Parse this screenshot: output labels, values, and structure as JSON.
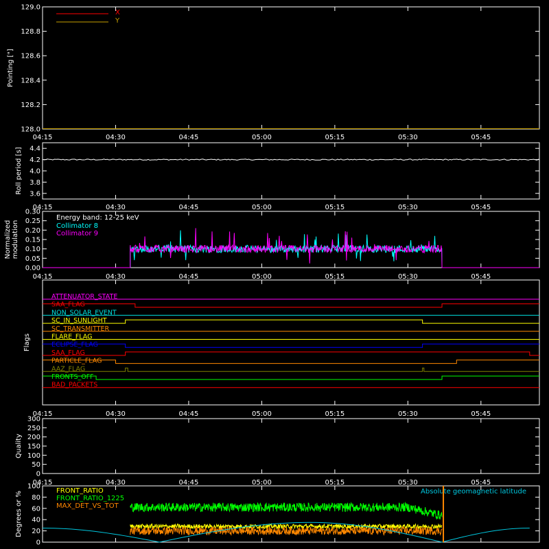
{
  "colors": {
    "bg": "#000000",
    "axes": "#ffffff",
    "x": "#ff0000",
    "y": "#c8a000",
    "roll": "#ffffff",
    "energy": "#ffffff",
    "coll8": "#00ffff",
    "coll9": "#ff00ff",
    "front_ratio": "#ffff00",
    "front_ratio_1225": "#00ff00",
    "max_det": "#ff8800",
    "geolat": "#00c8e0",
    "quality": "#ffffff"
  },
  "time_axis": {
    "min": "04:15",
    "max": "05:57",
    "ticks": [
      "04:15",
      "04:30",
      "04:45",
      "05:00",
      "05:15",
      "05:30",
      "05:45"
    ]
  },
  "chart_data": [
    {
      "id": "pointing",
      "type": "line",
      "ylabel": "Pointing [\"]",
      "ylim": [
        128.0,
        129.0
      ],
      "yticks": [
        "128.0",
        "128.2",
        "128.4",
        "128.6",
        "128.8",
        "129.0"
      ],
      "series": [
        {
          "name": "X",
          "color_key": "x",
          "t": [
            "04:15",
            "05:57"
          ],
          "values": [
            128.0,
            128.0
          ]
        },
        {
          "name": "Y",
          "color_key": "y",
          "t": [
            "04:15",
            "05:57"
          ],
          "values": [
            128.0,
            128.0
          ]
        }
      ]
    },
    {
      "id": "roll",
      "type": "line",
      "ylabel": "Roll period [s]",
      "ylim": [
        3.5,
        4.5
      ],
      "yticks": [
        "3.6",
        "3.8",
        "4.0",
        "4.2",
        "4.4"
      ],
      "series": [
        {
          "color_key": "roll",
          "t": [
            "04:15",
            "05:57"
          ],
          "values": [
            4.2,
            4.2
          ],
          "noise": 0.01
        }
      ]
    },
    {
      "id": "modulation",
      "type": "line",
      "ylabel": [
        "Normalized",
        "modulation"
      ],
      "ylim": [
        0.0,
        0.3
      ],
      "yticks": [
        "0.00",
        "0.05",
        "0.10",
        "0.15",
        "0.20",
        "0.25",
        "0.30"
      ],
      "legend_title": "Energy band: 12-25 keV",
      "active": [
        "04:33",
        "05:37"
      ],
      "series": [
        {
          "name": "Collimator 8",
          "color_key": "coll8",
          "base": 0.1,
          "noise": 0.02
        },
        {
          "name": "Collimator 9",
          "color_key": "coll9",
          "base": 0.1,
          "noise": 0.02
        }
      ]
    },
    {
      "id": "flags",
      "type": "step",
      "ylabel": "Flags",
      "flags": [
        {
          "name": "ATTENUATOR_STATE",
          "color": "#ff00ff",
          "steps": [
            [
              "04:15",
              0
            ]
          ]
        },
        {
          "name": "SAA_FLAG",
          "color": "#ff0000",
          "steps": [
            [
              "04:15",
              1
            ],
            [
              "04:34",
              0
            ],
            [
              "05:37",
              1
            ]
          ]
        },
        {
          "name": "NON_SOLAR_EVENT",
          "color": "#00e0e0",
          "steps": [
            [
              "04:15",
              0
            ]
          ]
        },
        {
          "name": "SC_IN_SUNLIGHT",
          "color": "#ffff00",
          "steps": [
            [
              "04:15",
              0
            ],
            [
              "04:32",
              1
            ],
            [
              "05:33",
              0
            ]
          ]
        },
        {
          "name": "SC_TRANSMITTER",
          "color": "#ff8800",
          "steps": [
            [
              "04:15",
              0
            ]
          ]
        },
        {
          "name": "FLARE_FLAG",
          "color": "#ffff00",
          "steps": [
            [
              "04:15",
              0
            ]
          ]
        },
        {
          "name": "ECLIPSE_FLAG",
          "color": "#0000ff",
          "steps": [
            [
              "04:15",
              1
            ],
            [
              "04:32",
              0
            ],
            [
              "05:33",
              1
            ]
          ]
        },
        {
          "name": "SAA_FLAG",
          "color": "#ff0000",
          "steps": [
            [
              "04:15",
              0
            ],
            [
              "04:32",
              1
            ],
            [
              "05:55",
              0
            ]
          ]
        },
        {
          "name": "PARTICLE_FLAG",
          "color": "#ff8800",
          "steps": [
            [
              "04:15",
              1
            ],
            [
              "04:30",
              0
            ],
            [
              "05:40",
              1
            ]
          ]
        },
        {
          "name": "AAZ_FLAG",
          "color": "#808000",
          "steps": [
            [
              "04:15",
              0
            ],
            [
              "04:32",
              1
            ],
            [
              "04:32.5",
              0
            ],
            [
              "05:33",
              1
            ],
            [
              "05:33.3",
              0
            ]
          ]
        },
        {
          "name": "FRONTS_OFF",
          "color": "#00ff00",
          "steps": [
            [
              "04:15",
              1
            ],
            [
              "04:26",
              0
            ],
            [
              "05:37",
              1
            ]
          ]
        },
        {
          "name": "BAD_PACKETS",
          "color": "#ff0000",
          "steps": [
            [
              "04:15",
              0
            ]
          ]
        }
      ]
    },
    {
      "id": "quality",
      "type": "line",
      "ylabel": "Quality",
      "ylim": [
        0,
        300
      ],
      "yticks": [
        "0",
        "50",
        "100",
        "150",
        "200",
        "250",
        "300"
      ],
      "series": []
    },
    {
      "id": "ratios",
      "type": "line",
      "ylabel": "Degrees or %",
      "ylim": [
        0,
        100
      ],
      "yticks": [
        "0",
        "20",
        "40",
        "60",
        "80",
        "100"
      ],
      "active": [
        "04:33",
        "05:37"
      ],
      "annotation": "Absolute geomagnetic latitude",
      "annotation_color_key": "geolat",
      "series": [
        {
          "name": "FRONT_RATIO",
          "color_key": "front_ratio",
          "base": 28,
          "noise": 4
        },
        {
          "name": "FRONT_RATIO_1225",
          "color_key": "front_ratio_1225",
          "base": 62,
          "noise": 8
        },
        {
          "name": "MAX_DET_VS_TOT",
          "color_key": "max_det",
          "base": 20,
          "noise": 7
        }
      ],
      "geolat": {
        "t": [
          "04:15",
          "04:39",
          "05:10",
          "05:37",
          "05:55"
        ],
        "values": [
          25,
          0,
          35,
          0,
          25
        ]
      }
    }
  ]
}
